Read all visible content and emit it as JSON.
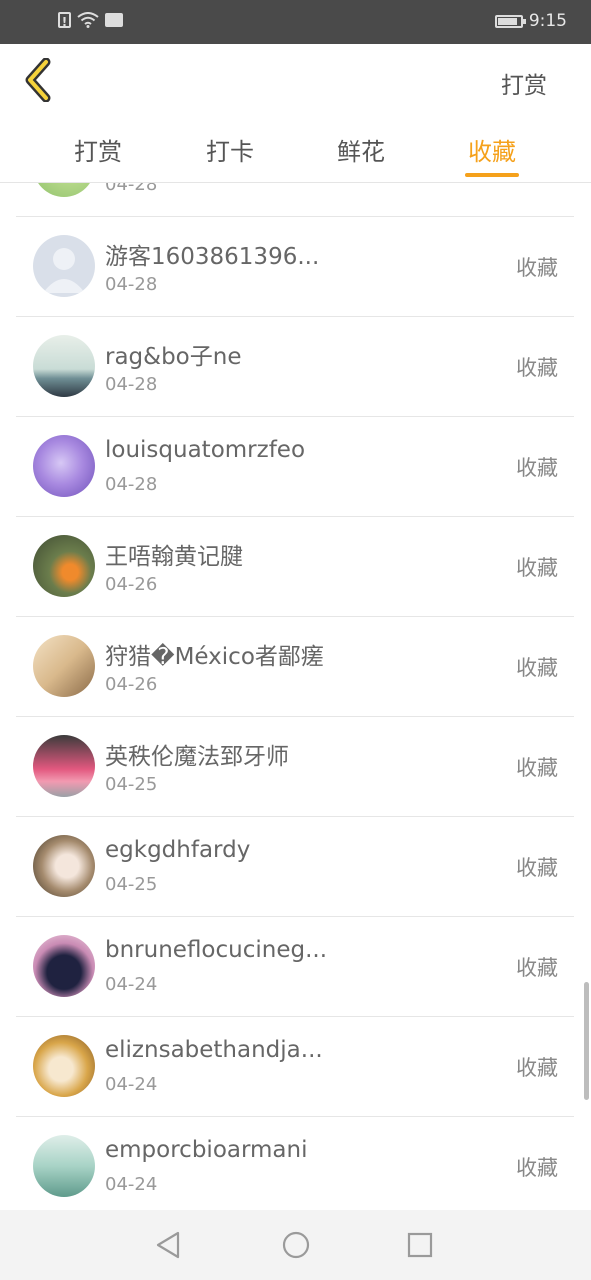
{
  "status_bar": {
    "time": "9:15",
    "icons": [
      "alert-icon",
      "wifi-icon",
      "nfc-icon",
      "battery-icon"
    ],
    "battery_level": 0.85
  },
  "header": {
    "back_icon": "chevron-left-icon",
    "action_label": "打赏"
  },
  "tabs": [
    {
      "label": "打赏",
      "active": false
    },
    {
      "label": "打卡",
      "active": false
    },
    {
      "label": "鲜花",
      "active": false
    },
    {
      "label": "收藏",
      "active": true
    }
  ],
  "accent_color": "#f5a11b",
  "list": {
    "partial_top_date": "04-28",
    "items": [
      {
        "name": "游客1603861396...",
        "date": "04-28",
        "action": "收藏"
      },
      {
        "name": "rag&bo子ne",
        "date": "04-28",
        "action": "收藏"
      },
      {
        "name": "louisquatomrzfeo",
        "date": "04-28",
        "action": "收藏"
      },
      {
        "name": "王唔翰黄记腱",
        "date": "04-26",
        "action": "收藏"
      },
      {
        "name": "狩猎�México者鄙瘥",
        "date": "04-26",
        "action": "收藏"
      },
      {
        "name": "英秩伦魔法郅牙师",
        "date": "04-25",
        "action": "收藏"
      },
      {
        "name": "egkgdhfardy",
        "date": "04-25",
        "action": "收藏"
      },
      {
        "name": "bnruneflocucineg...",
        "date": "04-24",
        "action": "收藏"
      },
      {
        "name": "eliznsabethandja...",
        "date": "04-24",
        "action": "收藏"
      },
      {
        "name": "emporcbioarmani",
        "date": "04-24",
        "action": "收藏"
      }
    ]
  },
  "nav": {
    "back_icon": "triangle-back-icon",
    "home_icon": "circle-home-icon",
    "recents_icon": "square-recents-icon"
  }
}
